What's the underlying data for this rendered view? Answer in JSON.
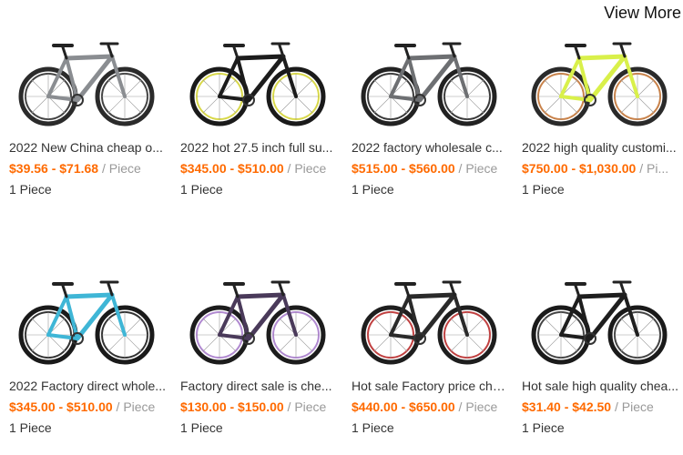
{
  "header": {
    "view_more": "View More"
  },
  "products": [
    {
      "title": "2022 New China cheap o...",
      "price": "$39.56 - $71.68",
      "unit": " / Piece",
      "moq": "1 Piece",
      "frame_color": "#8a8d91",
      "rim_color": "#444444",
      "tire_color": "#2b2b2b"
    },
    {
      "title": "2022 hot 27.5 inch full su...",
      "price": "$345.00 - $510.00",
      "unit": " / Piece",
      "moq": "1 Piece",
      "frame_color": "#1c1c1c",
      "rim_color": "#d8d84a",
      "tire_color": "#1a1a1a"
    },
    {
      "title": "2022 factory wholesale c...",
      "price": "$515.00 - $560.00",
      "unit": " / Piece",
      "moq": "1 Piece",
      "frame_color": "#6d6f72",
      "rim_color": "#3a3a3a",
      "tire_color": "#222222"
    },
    {
      "title": "2022 high quality customi...",
      "price": "$750.00 - $1,030.00",
      "unit": " / Pi...",
      "moq": "1 Piece",
      "frame_color": "#d9f04a",
      "rim_color": "#c8824a",
      "tire_color": "#2a2a2a"
    },
    {
      "title": "2022 Factory direct whole...",
      "price": "$345.00 - $510.00",
      "unit": " / Piece",
      "moq": "1 Piece",
      "frame_color": "#3fb6d6",
      "rim_color": "#333333",
      "tire_color": "#1a1a1a"
    },
    {
      "title": "Factory direct sale is che...",
      "price": "$130.00 - $150.00",
      "unit": " / Piece",
      "moq": "1 Piece",
      "frame_color": "#4a3a5a",
      "rim_color": "#b089d0",
      "tire_color": "#1c1c1c"
    },
    {
      "title": "Hot sale Factory price che...",
      "price": "$440.00 - $650.00",
      "unit": " / Piece",
      "moq": "1 Piece",
      "frame_color": "#2a2a2a",
      "rim_color": "#c04040",
      "tire_color": "#1e1e1e"
    },
    {
      "title": "Hot sale high quality chea...",
      "price": "$31.40 - $42.50",
      "unit": " / Piece",
      "moq": "1 Piece",
      "frame_color": "#1e1e1e",
      "rim_color": "#444444",
      "tire_color": "#1a1a1a"
    }
  ]
}
